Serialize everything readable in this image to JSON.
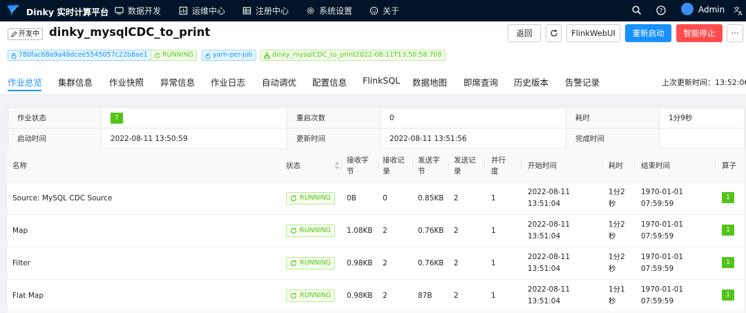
{
  "nav": {
    "brand": "Dinky 实时计算平台",
    "items": [
      "数据开发",
      "运维中心",
      "注册中心",
      "系统设置",
      "关于"
    ],
    "user": "Admin"
  },
  "job": {
    "status_badge": "开发中",
    "name": "dinky_mysqlCDC_to_print",
    "tags": {
      "jid": "780fac68a9a48dcee5545057c22b8ae1",
      "state": "RUNNING",
      "type": "yarn-per-job",
      "instance": "dinky_mysqlCDC_to_print2022-08-11T13:50:58.708"
    },
    "buttons": {
      "back": "返回",
      "webui": "FlinkWebUI",
      "restart": "重新启动",
      "stop": "智能停止",
      "more": "···"
    }
  },
  "tabs": [
    "作业总览",
    "集群信息",
    "作业快照",
    "异常信息",
    "作业日志",
    "自动调优",
    "配置信息",
    "FlinkSQL",
    "数据地图",
    "即席查询",
    "历史版本",
    "告警记录"
  ],
  "last_update": "上次更新时间：13:52:06",
  "summary": {
    "r1": [
      {
        "label": "作业状态",
        "value": "7"
      },
      {
        "label": "重启次数",
        "value": "0"
      },
      {
        "label": "耗时",
        "value": "1分9秒"
      }
    ],
    "r2": [
      {
        "label": "启动时间",
        "value": "2022-08-11 13:50:59"
      },
      {
        "label": "更新时间",
        "value": "2022-08-11 13:51:56"
      },
      {
        "label": "完成时间",
        "value": ""
      }
    ]
  },
  "table": {
    "headers": {
      "name": "名称",
      "status": "状态",
      "recv_bytes": [
        "接收字",
        "节"
      ],
      "recv_records": [
        "接收记",
        "录"
      ],
      "send_bytes": [
        "发送字",
        "节"
      ],
      "send_records": [
        "发送记",
        "录"
      ],
      "parallelism": [
        "并行",
        "度"
      ],
      "start": "开始时间",
      "duration": "耗时",
      "end": "结束时间",
      "ops": "算子"
    },
    "rows": [
      {
        "name": "Source: MySQL CDC Source",
        "status": "RUNNING",
        "recv_bytes": "0B",
        "recv_records": "0",
        "send_bytes": "0.85KB",
        "send_records": "2",
        "parallelism": "1",
        "start": [
          "2022-08-11",
          "13:51:04"
        ],
        "duration": [
          "1分2",
          "秒"
        ],
        "end": [
          "1970-01-01",
          "07:59:59"
        ],
        "ops": "1"
      },
      {
        "name": "Map",
        "status": "RUNNING",
        "recv_bytes": "1.08KB",
        "recv_records": "2",
        "send_bytes": "0.76KB",
        "send_records": "2",
        "parallelism": "1",
        "start": [
          "2022-08-11",
          "13:51:04"
        ],
        "duration": [
          "1分2",
          "秒"
        ],
        "end": [
          "1970-01-01",
          "07:59:59"
        ],
        "ops": "1"
      },
      {
        "name": "Filter",
        "status": "RUNNING",
        "recv_bytes": "0.98KB",
        "recv_records": "2",
        "send_bytes": "0.76KB",
        "send_records": "2",
        "parallelism": "1",
        "start": [
          "2022-08-11",
          "13:51:04"
        ],
        "duration": [
          "1分2",
          "秒"
        ],
        "end": [
          "1970-01-01",
          "07:59:59"
        ],
        "ops": "1"
      },
      {
        "name": "Flat Map",
        "status": "RUNNING",
        "recv_bytes": "0.98KB",
        "recv_records": "2",
        "send_bytes": "87B",
        "send_records": "2",
        "parallelism": "1",
        "start": [
          "2022-08-11",
          "13:51:04"
        ],
        "duration": [
          "1分1",
          "秒"
        ],
        "end": [
          "1970-01-01",
          "07:59:59"
        ],
        "ops": "1"
      }
    ]
  },
  "colors": {
    "nav_bg": "#001529",
    "primary": "#1890ff",
    "danger": "#ff4d4f",
    "success": "#52c41a"
  }
}
